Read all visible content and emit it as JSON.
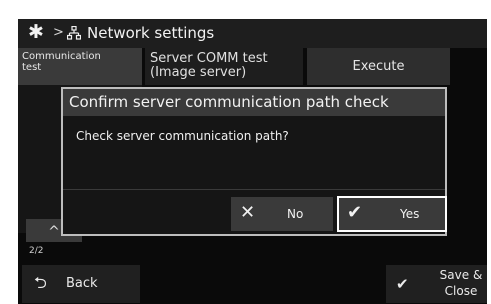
{
  "header": {
    "gear_icon": "gear-icon",
    "separator": ">",
    "network_icon": "network-icon",
    "title": "Network settings"
  },
  "settings_row": {
    "left_label": "Communication\ntest",
    "item_label": "Server COMM test\n(Image server)",
    "execute_label": "Execute"
  },
  "pager": {
    "up_glyph": "^",
    "page": "2/2"
  },
  "footer": {
    "back_label": "Back",
    "back_icon": "return-arrow-icon",
    "save_label": "Save &\nClose",
    "save_icon": "check-icon"
  },
  "dialog": {
    "title": "Confirm server communication path check",
    "message": "Check server communication path?",
    "no_label": "No",
    "yes_label": "Yes",
    "no_icon": "x-icon",
    "yes_icon": "check-icon"
  },
  "colors": {
    "background": "#0a0a0a",
    "button": "#3a3a3a",
    "focus_border": "#ffffff"
  }
}
